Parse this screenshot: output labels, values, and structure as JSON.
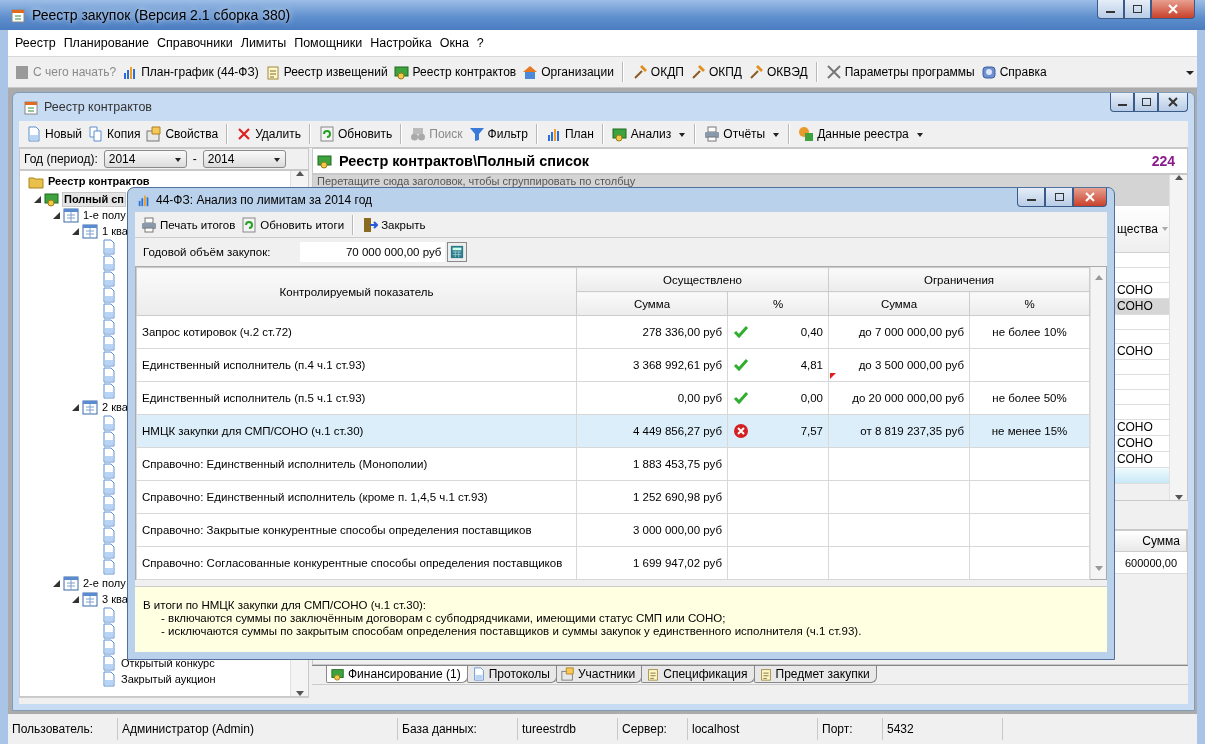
{
  "window": {
    "title": "Реестр закупок (Версия 2.1 сборка 380)"
  },
  "menu": [
    "Реестр",
    "Планирование",
    "Справочники",
    "Лимиты",
    "Помощники",
    "Настройка",
    "Окна",
    "?"
  ],
  "toolbar": [
    [
      {
        "label": "С чего начать?",
        "disabled": true
      },
      {
        "label": "План-график (44-ФЗ)",
        "disabled": false
      },
      {
        "label": "Реестр извещений",
        "disabled": false
      },
      {
        "label": "Реестр контрактов",
        "disabled": false
      },
      {
        "label": "Организации",
        "disabled": false
      }
    ],
    [
      {
        "label": "ОКДП",
        "disabled": false
      },
      {
        "label": "ОКПД",
        "disabled": false
      },
      {
        "label": "ОКВЭД",
        "disabled": false
      }
    ],
    [
      {
        "label": "Параметры программы",
        "disabled": false
      },
      {
        "label": "Справка",
        "disabled": false
      }
    ]
  ],
  "child_window": {
    "title": "Реестр контрактов",
    "toolbar": [
      [
        {
          "label": "Новый",
          "disabled": false,
          "dropdown": false
        },
        {
          "label": "Копия",
          "disabled": false,
          "dropdown": false
        },
        {
          "label": "Свойства",
          "disabled": false,
          "dropdown": false
        }
      ],
      [
        {
          "label": "Удалить",
          "disabled": false,
          "dropdown": false
        }
      ],
      [
        {
          "label": "Обновить",
          "disabled": false,
          "dropdown": false
        }
      ],
      [
        {
          "label": "Поиск",
          "disabled": true,
          "dropdown": false
        },
        {
          "label": "Фильтр",
          "disabled": false,
          "dropdown": false
        }
      ],
      [
        {
          "label": "План",
          "disabled": false,
          "dropdown": false
        }
      ],
      [
        {
          "label": "Анализ",
          "disabled": false,
          "dropdown": true
        }
      ],
      [
        {
          "label": "Отчёты",
          "disabled": false,
          "dropdown": true
        }
      ],
      [
        {
          "label": "Данные реестра",
          "disabled": false,
          "dropdown": true
        }
      ]
    ],
    "period": {
      "label": "Год (период):",
      "from": "2014",
      "separator": "-",
      "to": "2014"
    },
    "tree": {
      "label": "Реестр контрактов",
      "kind": "folder",
      "selected": false,
      "children": [
        {
          "label": "Полный сп",
          "kind": "register",
          "selected": true,
          "expanded": true,
          "children": [
            {
              "label": "1-е полу",
              "kind": "period",
              "selected": false,
              "expanded": true,
              "children": [
                {
                  "label": "1 ква",
                  "kind": "period",
                  "selected": false,
                  "expanded": true,
                  "children": [
                    {
                      "kind": "document",
                      "selected": false
                    },
                    {
                      "kind": "document",
                      "selected": false
                    },
                    {
                      "kind": "document",
                      "selected": false
                    },
                    {
                      "kind": "document",
                      "selected": false
                    },
                    {
                      "kind": "document",
                      "selected": false
                    },
                    {
                      "kind": "document",
                      "selected": false
                    },
                    {
                      "kind": "document",
                      "selected": false
                    },
                    {
                      "kind": "document",
                      "selected": false
                    },
                    {
                      "kind": "document",
                      "selected": false
                    },
                    {
                      "kind": "document",
                      "selected": false
                    }
                  ]
                },
                {
                  "label": "2 ква",
                  "kind": "period",
                  "selected": false,
                  "expanded": true,
                  "children": [
                    {
                      "kind": "document",
                      "selected": false
                    },
                    {
                      "kind": "document",
                      "selected": false
                    },
                    {
                      "kind": "document",
                      "selected": false
                    },
                    {
                      "kind": "document",
                      "selected": false
                    },
                    {
                      "kind": "document",
                      "selected": false
                    },
                    {
                      "kind": "document",
                      "selected": false
                    },
                    {
                      "kind": "document",
                      "selected": false
                    },
                    {
                      "kind": "document",
                      "selected": false
                    },
                    {
                      "kind": "document",
                      "selected": false
                    },
                    {
                      "kind": "document",
                      "selected": false
                    }
                  ]
                }
              ]
            },
            {
              "label": "2-е полу",
              "kind": "period",
              "selected": false,
              "expanded": true,
              "children": [
                {
                  "label": "3 ква",
                  "kind": "period",
                  "selected": false,
                  "expanded": true,
                  "children": [
                    {
                      "kind": "document",
                      "selected": false
                    },
                    {
                      "kind": "document",
                      "selected": false
                    },
                    {
                      "kind": "document",
                      "selected": false
                    },
                    {
                      "label": "Открытый конкурс",
                      "kind": "document",
                      "selected": false
                    },
                    {
                      "label": "Закрытый аукцион",
                      "kind": "document",
                      "selected": false
                    }
                  ]
                }
              ]
            }
          ]
        }
      ]
    },
    "list_title": "Реестр контрактов\\Полный список",
    "count": "224",
    "group_hint": "Перетащите сюда заголовок, чтобы сгруппировать по столбцу",
    "grid": {
      "column": "щества",
      "rows": [
        {
          "selected": false
        },
        {
          "selected": false
        },
        {
          "text": "СОНО",
          "selected": false
        },
        {
          "text": "СОНО",
          "selected": true
        },
        {
          "selected": false
        },
        {
          "selected": false
        },
        {
          "text": "СОНО",
          "selected": false
        },
        {
          "selected": false
        },
        {
          "selected": false
        },
        {
          "selected": false
        },
        {
          "selected": false
        },
        {
          "text": "СОНО",
          "selected": false
        },
        {
          "text": "СОНО",
          "selected": false
        },
        {
          "text": "СОНО",
          "selected": false
        }
      ]
    },
    "detail": {
      "column": "Сумма",
      "rows": [
        "600000,00"
      ]
    },
    "tabs": [
      {
        "label": "Финансирование (1)",
        "selected": true
      },
      {
        "label": "Протоколы",
        "selected": false
      },
      {
        "label": "Участники",
        "selected": false
      },
      {
        "label": "Спецификация",
        "selected": false
      },
      {
        "label": "Предмет закупки",
        "selected": false
      }
    ]
  },
  "dialog": {
    "title": "44-ФЗ: Анализ по лимитам за 2014 год",
    "toolbar": [
      [
        "Печать итогов",
        "Обновить итоги"
      ],
      [
        "Закрыть"
      ]
    ],
    "volume": {
      "label": "Годовой объём закупок:",
      "value": "70 000 000,00 руб"
    },
    "headers": {
      "indicator": "Контролируемый показатель",
      "done": "Осуществлено",
      "limits": "Ограничения",
      "sum": "Сумма",
      "percent": "%",
      "limit_sum": "Сумма",
      "limit_percent": "%"
    },
    "rows": [
      {
        "label": "Запрос котировок (ч.2 ст.72)",
        "sum": "278 336,00 руб",
        "ok": true,
        "percent": "0,40",
        "limit": "до 7 000 000,00 руб",
        "limit_percent": "не более 10%",
        "selected": false,
        "flagged": false
      },
      {
        "label": "Единственный исполнитель (п.4 ч.1 ст.93)",
        "sum": "3 368 992,61 руб",
        "ok": true,
        "percent": "4,81",
        "limit": "до 3 500 000,00 руб",
        "selected": false,
        "flagged": true
      },
      {
        "label": "Единственный исполнитель (п.5 ч.1 ст.93)",
        "sum": "0,00 руб",
        "ok": true,
        "percent": "0,00",
        "limit": "до 20 000 000,00 руб",
        "limit_percent": "не более 50%",
        "selected": false,
        "flagged": false
      },
      {
        "label": "НМЦК закупки для СМП/СОНО (ч.1 ст.30)",
        "sum": "4 449 856,27 руб",
        "ok": false,
        "percent": "7,57",
        "limit": "от 8 819 237,35 руб",
        "limit_percent": "не менее 15%",
        "selected": true,
        "flagged": false
      },
      {
        "label": "Справочно: Единственный исполнитель (Монополии)",
        "sum": "1 883 453,75 руб",
        "selected": false,
        "flagged": false
      },
      {
        "label": "Справочно: Единственный исполнитель (кроме п. 1,4,5 ч.1 ст.93)",
        "sum": "1 252 690,98 руб",
        "selected": false,
        "flagged": false
      },
      {
        "label": "Справочно: Закрытые конкурентные способы определения поставщиков",
        "sum": "3 000 000,00 руб",
        "selected": false,
        "flagged": false
      },
      {
        "label": "Справочно: Согласованные конкурентные способы определения поставщиков",
        "sum": "1 699 947,02 руб",
        "selected": false,
        "flagged": false
      }
    ],
    "note": [
      "В итоги по НМЦК закупки для СМП/СОНО (ч.1 ст.30):",
      "- включаются суммы по заключённым договорам с субподрядчиками, имеющими статус СМП или СОНО;",
      "- исключаются суммы по закрытым способам определения поставщиков и суммы закупок у единственного исполнителя (ч.1 ст.93)."
    ]
  },
  "status_bar": [
    {
      "label": "Пользователь:",
      "value": "Администратор (Admin)"
    },
    {
      "label": "База данных:",
      "value": "tureestrdb"
    },
    {
      "label": "Сервер:",
      "value": "localhost"
    },
    {
      "label": "Порт:",
      "value": "5432"
    }
  ]
}
